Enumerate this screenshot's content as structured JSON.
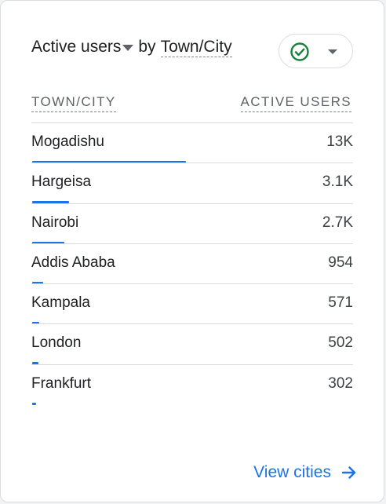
{
  "header": {
    "metric_label": "Active users",
    "by_label": "by",
    "dimension_label": "Town/City"
  },
  "status_chip": {
    "icon": "check-circle-icon",
    "status_color": "#188038"
  },
  "table": {
    "columns": [
      "TOWN/CITY",
      "ACTIVE USERS"
    ],
    "rows": [
      {
        "city": "Mogadishu",
        "value_label": "13K",
        "share": 1.0
      },
      {
        "city": "Hargeisa",
        "value_label": "3.1K",
        "share": 0.238
      },
      {
        "city": "Nairobi",
        "value_label": "2.7K",
        "share": 0.208
      },
      {
        "city": "Addis Ababa",
        "value_label": "954",
        "share": 0.073
      },
      {
        "city": "Kampala",
        "value_label": "571",
        "share": 0.044
      },
      {
        "city": "London",
        "value_label": "502",
        "share": 0.039
      },
      {
        "city": "Frankfurt",
        "value_label": "302",
        "share": 0.023
      }
    ]
  },
  "footer": {
    "link_label": "View cities",
    "icon": "arrow-right-icon"
  },
  "colors": {
    "accent": "#1a73e8",
    "text_primary": "#202124",
    "text_secondary": "#5f6368",
    "divider": "#dadce0"
  }
}
